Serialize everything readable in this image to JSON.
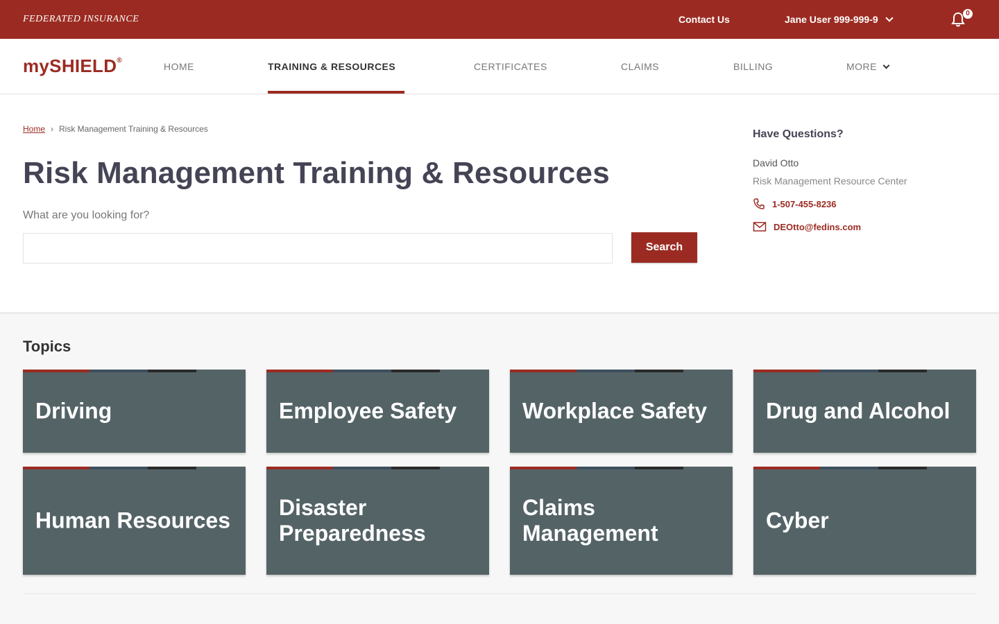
{
  "topbar": {
    "brand": "FEDERATED INSURANCE",
    "contact_label": "Contact Us",
    "user_label": "Jane User  999-999-9",
    "notification_count": "0",
    "bar_color": "#9b2b22"
  },
  "nav": {
    "logo": "mySHIELD",
    "logo_mark": "®",
    "items": [
      {
        "label": "HOME"
      },
      {
        "label": "TRAINING & RESOURCES",
        "active": true
      },
      {
        "label": "CERTIFICATES"
      },
      {
        "label": "CLAIMS"
      },
      {
        "label": "BILLING"
      },
      {
        "label": "MORE"
      }
    ]
  },
  "breadcrumb": {
    "home": "Home",
    "separator": "›",
    "current": "Risk Management Training & Resources"
  },
  "page": {
    "title": "Risk Management Training & Resources",
    "search_label": "What are you looking for?",
    "search_value": "",
    "search_button": "Search"
  },
  "questions": {
    "title": "Have Questions?",
    "name": "David Otto",
    "role": "Risk Management Resource Center",
    "phone": "1-507-455-8236",
    "email": "DEOtto@fedins.com"
  },
  "topics": {
    "heading": "Topics",
    "tile_color": "#546366",
    "accent_colors": [
      "#9b2b22",
      "#3d4f5e",
      "#2a2a2a"
    ],
    "items": [
      {
        "label": "Driving"
      },
      {
        "label": "Employee Safety"
      },
      {
        "label": "Workplace Safety"
      },
      {
        "label": "Drug and Alcohol"
      },
      {
        "label": "Human Resources"
      },
      {
        "label": "Disaster Preparedness"
      },
      {
        "label": "Claims Management"
      },
      {
        "label": "Cyber"
      }
    ]
  }
}
